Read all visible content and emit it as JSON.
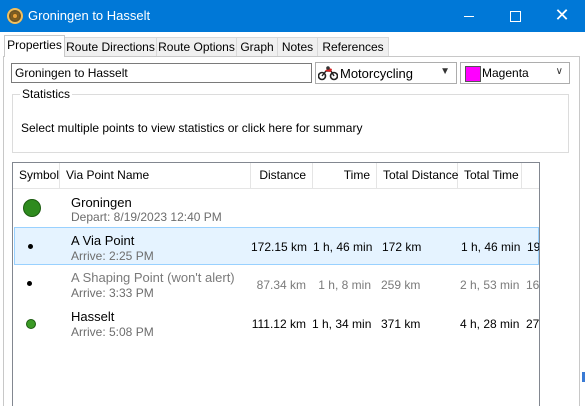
{
  "window": {
    "title": "Groningen to Hasselt",
    "minimize_icon": "minimize-icon",
    "maximize_icon": "maximize-icon",
    "close_icon": "close-icon",
    "close_glyph": "✕"
  },
  "tabs": [
    "Properties",
    "Route Directions",
    "Route Options",
    "Graph",
    "Notes",
    "References"
  ],
  "route_name": "Groningen to Hasselt",
  "vehicle": {
    "icon": "motorcycle-icon",
    "value": "Motorcycling"
  },
  "color": {
    "value": "Magenta",
    "hex": "#ff00ff"
  },
  "statistics": {
    "legend": "Statistics",
    "message": "Select multiple points to view statistics or click here for summary"
  },
  "columns": [
    "Symbol",
    "Via Point Name",
    "Distance",
    "Time",
    "Total Distance",
    "Total Time"
  ],
  "rows": [
    {
      "name": "Groningen",
      "sub": "Depart: 8/19/2023 12:40 PM",
      "distance": "",
      "time": "",
      "total_distance": "",
      "total_time": "",
      "extra": "",
      "symbol": "large-green-circle-icon",
      "symbol_color": "#2e8b1e"
    },
    {
      "name": "A Via Point",
      "sub": "Arrive: 2:25 PM",
      "distance": "172.15 km",
      "time": "1 h, 46 min",
      "total_distance": "172 km",
      "total_time": "1 h, 46 min",
      "extra": "19",
      "symbol": "small-black-dot-icon",
      "symbol_color": "#000000"
    },
    {
      "name": "A Shaping Point (won't alert)",
      "sub": "Arrive: 3:33 PM",
      "distance": "87.34 km",
      "time": "1 h, 8 min",
      "total_distance": "259 km",
      "total_time": "2 h, 53 min",
      "extra": "16",
      "symbol": "small-black-dot-icon",
      "symbol_color": "#000000"
    },
    {
      "name": "Hasselt",
      "sub": "Arrive: 5:08 PM",
      "distance": "111.12 km",
      "time": "1 h, 34 min",
      "total_distance": "371 km",
      "total_time": "4 h, 28 min",
      "extra": "27",
      "symbol": "small-green-dot-icon",
      "symbol_color": "#3a9a25"
    }
  ]
}
